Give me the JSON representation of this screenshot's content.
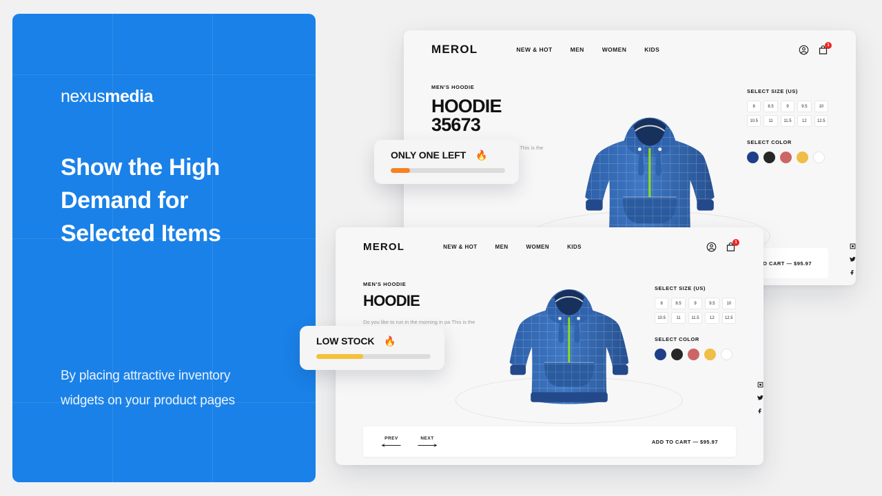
{
  "promo": {
    "logo_light": "nexus",
    "logo_bold": "media",
    "headline": "Show the High Demand for Selected Items",
    "subtext": "By placing attractive inventory widgets on your product pages",
    "bg_color": "#1a81e8"
  },
  "stock_widgets": [
    {
      "label": "ONLY ONE LEFT",
      "flame": "🔥",
      "fill_percent": 17,
      "bar_color": "#f5821f"
    },
    {
      "label": "LOW STOCK",
      "flame": "🔥",
      "fill_percent": 41,
      "bar_color": "#f3c13a"
    }
  ],
  "store": {
    "brand": "MEROL",
    "nav": [
      "NEW & HOT",
      "MEN",
      "WOMEN",
      "KIDS"
    ],
    "account_icon": "user-circle-icon",
    "cart_icon": "shopping-bag-icon",
    "cart_count": "1",
    "size_label": "SELECT SIZE (US)",
    "sizes": [
      "8",
      "8.5",
      "9",
      "9.5",
      "10",
      "10.5",
      "11",
      "11.5",
      "12",
      "12.5"
    ],
    "color_label": "SELECT COLOR",
    "colors": [
      "#1e4088",
      "#262626",
      "#cc6666",
      "#f0bd45",
      "#ffffff"
    ],
    "socials": [
      "instagram-icon",
      "twitter-icon",
      "facebook-icon"
    ],
    "prev_label": "PREV",
    "next_label": "NEXT",
    "add_to_cart": "ADD TO CART — $95.97",
    "add_to_cart_clipped": "D TO CART — $95.97"
  },
  "product_top": {
    "eyebrow": "MEN'S HOODIE",
    "title": "HOODIE 35673",
    "description": "Do you like to run in the morning in pa This is the best model for sports."
  },
  "product_bottom": {
    "eyebrow": "MEN'S HOODIE",
    "title": "HOODIE",
    "description": "Do you like to run in the morning in pa This is the best model for sports."
  }
}
